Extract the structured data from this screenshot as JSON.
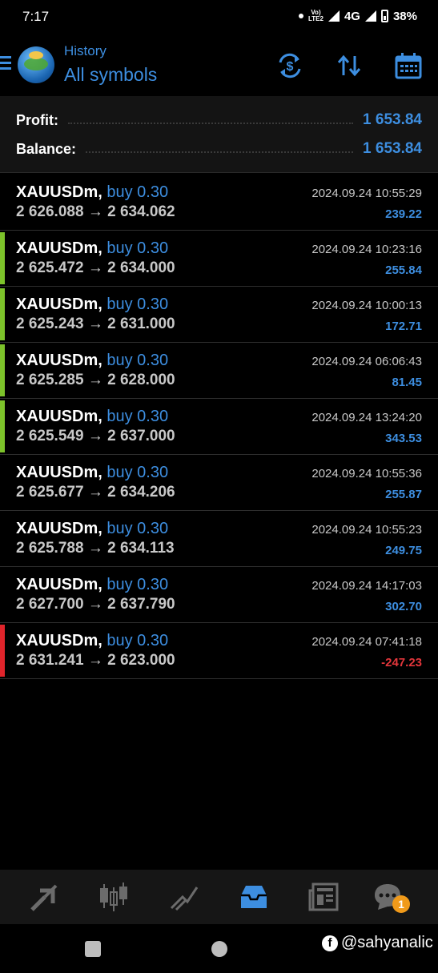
{
  "status_bar": {
    "time": "7:17",
    "volte": "Vo) LTE2",
    "network": "4G",
    "battery": "38%"
  },
  "header": {
    "subtitle": "History",
    "title": "All symbols",
    "icons": [
      "menu-icon",
      "metatrader-logo",
      "currency-exchange-icon",
      "sort-icon",
      "calendar-icon"
    ]
  },
  "summary": {
    "profit_label": "Profit:",
    "profit_value": "1 653.84",
    "balance_label": "Balance:",
    "balance_value": "1 653.84"
  },
  "trades": [
    {
      "symbol": "XAUUSDm,",
      "side": "buy 0.30",
      "open": "2 626.088",
      "arrow": "→",
      "close": "2 634.062",
      "date": "2024.09.24 10:55:29",
      "profit": "239.22",
      "bar": "none"
    },
    {
      "symbol": "XAUUSDm,",
      "side": "buy 0.30",
      "open": "2 625.472",
      "arrow": "→",
      "close": "2 634.000",
      "date": "2024.09.24 10:23:16",
      "profit": "255.84",
      "bar": "green"
    },
    {
      "symbol": "XAUUSDm,",
      "side": "buy 0.30",
      "open": "2 625.243",
      "arrow": "→",
      "close": "2 631.000",
      "date": "2024.09.24 10:00:13",
      "profit": "172.71",
      "bar": "green"
    },
    {
      "symbol": "XAUUSDm,",
      "side": "buy 0.30",
      "open": "2 625.285",
      "arrow": "→",
      "close": "2 628.000",
      "date": "2024.09.24 06:06:43",
      "profit": "81.45",
      "bar": "green"
    },
    {
      "symbol": "XAUUSDm,",
      "side": "buy 0.30",
      "open": "2 625.549",
      "arrow": "→",
      "close": "2 637.000",
      "date": "2024.09.24 13:24:20",
      "profit": "343.53",
      "bar": "green"
    },
    {
      "symbol": "XAUUSDm,",
      "side": "buy 0.30",
      "open": "2 625.677",
      "arrow": "→",
      "close": "2 634.206",
      "date": "2024.09.24 10:55:36",
      "profit": "255.87",
      "bar": "none"
    },
    {
      "symbol": "XAUUSDm,",
      "side": "buy 0.30",
      "open": "2 625.788",
      "arrow": "→",
      "close": "2 634.113",
      "date": "2024.09.24 10:55:23",
      "profit": "249.75",
      "bar": "none"
    },
    {
      "symbol": "XAUUSDm,",
      "side": "buy 0.30",
      "open": "2 627.700",
      "arrow": "→",
      "close": "2 637.790",
      "date": "2024.09.24 14:17:03",
      "profit": "302.70",
      "bar": "none"
    },
    {
      "symbol": "XAUUSDm,",
      "side": "buy 0.30",
      "open": "2 631.241",
      "arrow": "→",
      "close": "2 623.000",
      "date": "2024.09.24 07:41:18",
      "profit": "-247.23",
      "bar": "red"
    }
  ],
  "colors": {
    "accent": "#3d8ee0",
    "profit_positive": "#3d8ee0",
    "profit_negative": "#e2363b",
    "bar_green": "#7cc22a",
    "bar_red": "#e0242b"
  },
  "bottom_nav": {
    "items": [
      "quotes-icon",
      "chart-icon",
      "trade-icon",
      "history-icon",
      "news-icon",
      "chat-icon"
    ],
    "active": "history-icon",
    "chat_badge": "1"
  },
  "watermark": {
    "text": "@sahyanalic"
  }
}
